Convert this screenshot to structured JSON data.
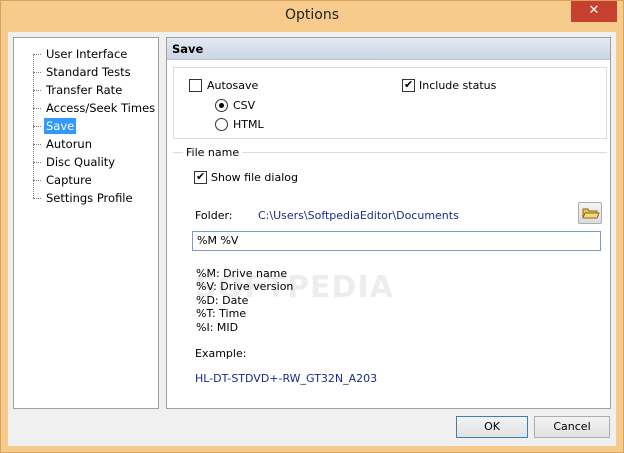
{
  "window": {
    "title": "Options",
    "close_glyph": "✕"
  },
  "sidebar": {
    "items": [
      {
        "label": "User Interface"
      },
      {
        "label": "Standard Tests"
      },
      {
        "label": "Transfer Rate"
      },
      {
        "label": "Access/Seek Times"
      },
      {
        "label": "Save",
        "selected": true
      },
      {
        "label": "Autorun"
      },
      {
        "label": "Disc Quality"
      },
      {
        "label": "Capture"
      },
      {
        "label": "Settings Profile"
      }
    ]
  },
  "panel": {
    "title": "Save",
    "save": {
      "autosave_label": "Autosave",
      "autosave_checked": false,
      "include_status_label": "Include status",
      "include_status_checked": true,
      "format_csv_label": "CSV",
      "format_html_label": "HTML",
      "selected_format": "CSV"
    },
    "file_name": {
      "group_label": "File name",
      "show_dialog_label": "Show file dialog",
      "show_dialog_checked": true,
      "folder_label": "Folder:",
      "folder_value": "C:\\Users\\SoftpediaEditor\\Documents",
      "pattern_value": "%M %V",
      "legend": [
        "%M: Drive name",
        "%V: Drive version",
        "%D: Date",
        "%T: Time",
        "%I: MID"
      ],
      "example_label": "Example:",
      "example_value": "HL-DT-STDVD+-RW_GT32N_A203"
    }
  },
  "footer": {
    "ok_label": "OK",
    "cancel_label": "Cancel"
  },
  "watermark": "SOFTPEDIA",
  "colors": {
    "accent_selected": "#3399ff",
    "close": "#c7402f",
    "frame": "#f6cb8c",
    "link_text": "#1a2b8a"
  }
}
